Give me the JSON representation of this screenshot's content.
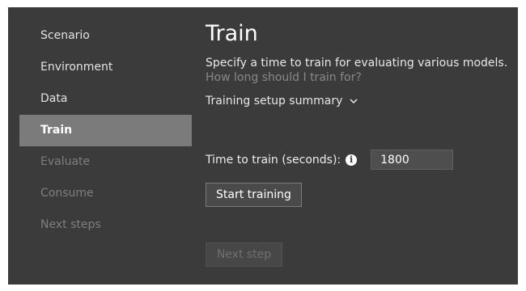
{
  "sidebar": {
    "items": [
      {
        "label": "Scenario",
        "state": "normal"
      },
      {
        "label": "Environment",
        "state": "normal"
      },
      {
        "label": "Data",
        "state": "normal"
      },
      {
        "label": "Train",
        "state": "selected"
      },
      {
        "label": "Evaluate",
        "state": "disabled"
      },
      {
        "label": "Consume",
        "state": "disabled"
      },
      {
        "label": "Next steps",
        "state": "disabled"
      }
    ]
  },
  "main": {
    "title": "Train",
    "description": "Specify a time to train for evaluating various models.",
    "help_link": "How long should I train for?",
    "summary_label": "Training setup summary",
    "summary_icon": "chevron-down-icon",
    "time_label": "Time to train (seconds):",
    "info_icon": "info-icon",
    "time_value": "1800",
    "start_button": "Start training",
    "next_button": "Next step"
  },
  "colors": {
    "background": "#3b3b3b",
    "selected_nav": "#7b7b7b",
    "disabled_text": "#7e7e7e",
    "link": "#888888"
  }
}
